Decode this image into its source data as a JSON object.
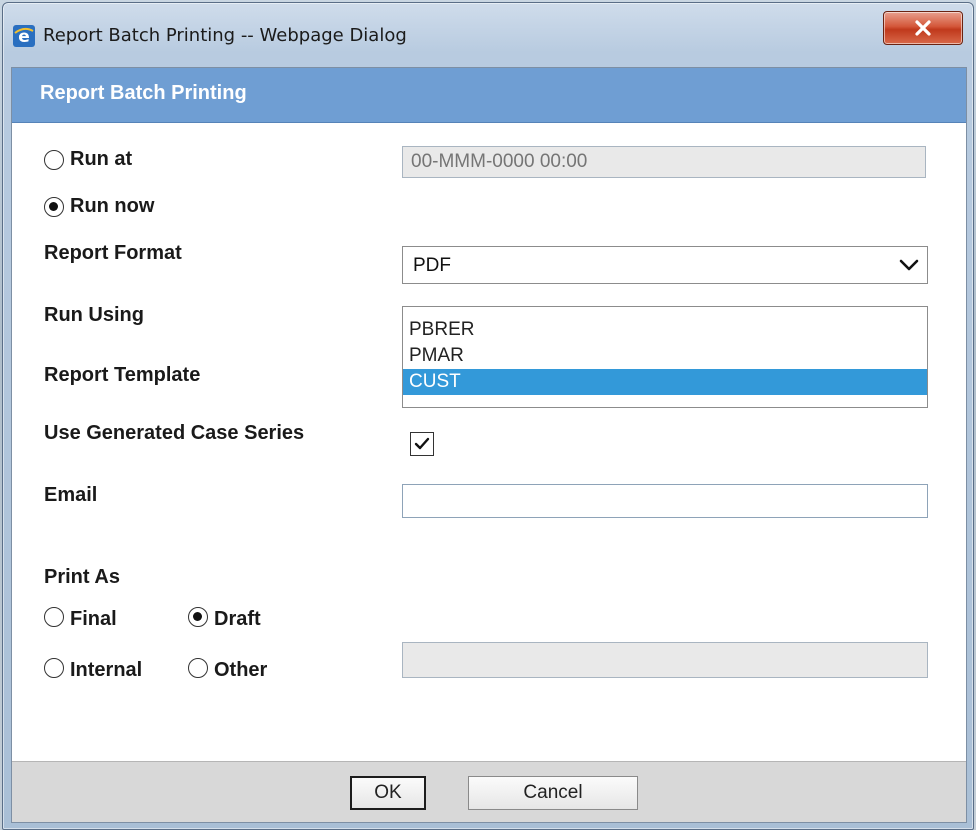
{
  "window": {
    "title": "Report Batch Printing -- Webpage Dialog"
  },
  "dialog": {
    "header": "Report Batch Printing",
    "run_at_label": "Run at",
    "run_at_placeholder": "00-MMM-0000 00:00",
    "run_now_label": "Run now",
    "run_mode_selected": "Run now",
    "report_format_label": "Report Format",
    "report_format_value": "PDF",
    "run_using_label": "Run Using",
    "report_template_label": "Report Template",
    "template_options": [
      {
        "label": "PBRER",
        "selected": false
      },
      {
        "label": "PMAR",
        "selected": false
      },
      {
        "label": "CUST",
        "selected": true
      }
    ],
    "use_generated_label": "Use Generated Case Series",
    "use_generated_checked": true,
    "email_label": "Email",
    "email_value": "",
    "print_as_label": "Print As",
    "print_as_options": [
      "Final",
      "Draft",
      "Internal",
      "Other"
    ],
    "print_as_selected": "Draft",
    "other_value": ""
  },
  "footer": {
    "ok_label": "OK",
    "cancel_label": "Cancel"
  },
  "colors": {
    "header_band": "#6f9ed3",
    "selected_option": "#3399d9",
    "close_button": "#c0391c"
  }
}
